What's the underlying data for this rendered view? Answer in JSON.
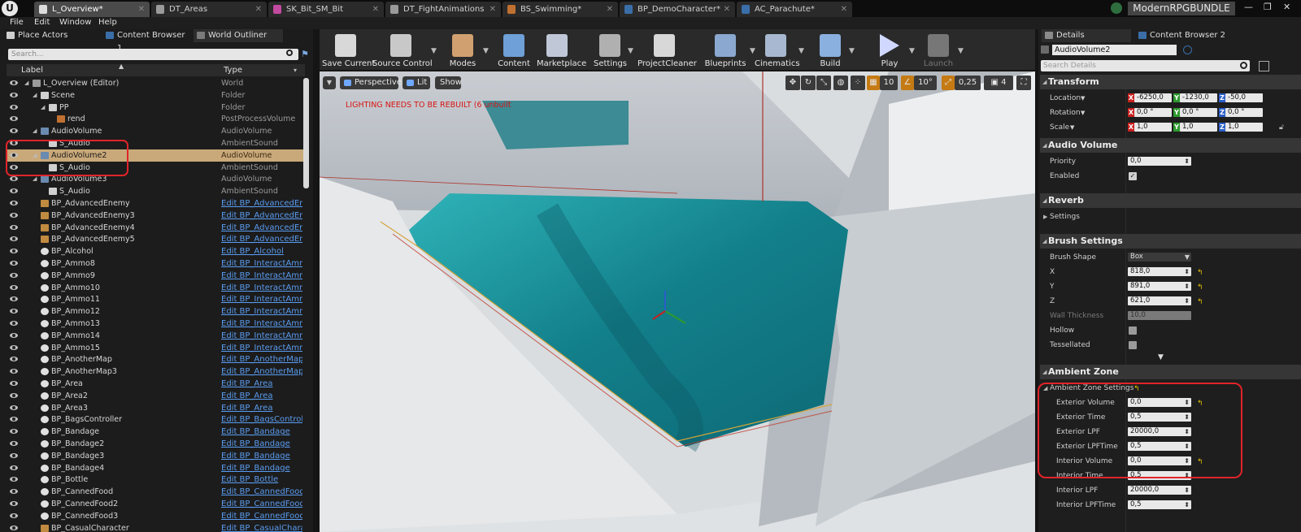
{
  "tabs": [
    {
      "label": "L_Overview*",
      "icon": "level-icon",
      "color": "#dcdcdc",
      "active": true
    },
    {
      "label": "DT_Areas",
      "icon": "datatable-icon",
      "color": "#9a9a9a"
    },
    {
      "label": "SK_Bit_SM_Bit",
      "icon": "skeleton-icon",
      "color": "#c24aa0"
    },
    {
      "label": "DT_FightAnimations",
      "icon": "datatable-icon",
      "color": "#9a9a9a"
    },
    {
      "label": "BS_Swimming*",
      "icon": "blendspace-icon",
      "color": "#c07030"
    },
    {
      "label": "BP_DemoCharacter*",
      "icon": "blueprint-icon",
      "color": "#3a6ea8"
    },
    {
      "label": "AC_Parachute*",
      "icon": "blueprint-icon",
      "color": "#3a6ea8"
    }
  ],
  "project_name": "ModernRPGBUNDLE",
  "menu": [
    "File",
    "Edit",
    "Window",
    "Help"
  ],
  "left_tabs": [
    "Place Actors",
    "Content Browser 1",
    "World Outliner"
  ],
  "search_placeholder": "Search...",
  "columns": {
    "label": "Label",
    "type": "Type"
  },
  "outliner_rows": [
    {
      "label": "L_Overview (Editor)",
      "type": "World",
      "indent": 0,
      "expanded": true,
      "icon": "world-icon"
    },
    {
      "label": "Scene",
      "type": "Folder",
      "indent": 1,
      "expanded": true,
      "icon": "folder-icon"
    },
    {
      "label": "PP",
      "type": "Folder",
      "indent": 2,
      "expanded": true,
      "icon": "folder-icon"
    },
    {
      "label": "rend",
      "type": "PostProcessVolume",
      "indent": 3,
      "icon": "volume-icon"
    },
    {
      "label": "AudioVolume",
      "type": "AudioVolume",
      "indent": 1,
      "expanded": true,
      "icon": "audio-volume-icon"
    },
    {
      "label": "S_Audio",
      "type": "AmbientSound",
      "indent": 2,
      "icon": "sound-icon"
    },
    {
      "label": "AudioVolume2",
      "type": "AudioVolume",
      "indent": 1,
      "expanded": true,
      "icon": "audio-volume-icon",
      "selected": true
    },
    {
      "label": "S_Audio",
      "type": "AmbientSound",
      "indent": 2,
      "icon": "sound-icon"
    },
    {
      "label": "AudioVolume3",
      "type": "AudioVolume",
      "indent": 1,
      "expanded": true,
      "icon": "audio-volume-icon"
    },
    {
      "label": "S_Audio",
      "type": "AmbientSound",
      "indent": 2,
      "icon": "sound-icon"
    },
    {
      "label": "BP_AdvancedEnemy",
      "type": "Edit BP_AdvancedEne",
      "indent": 1,
      "icon": "actor-icon",
      "link": true
    },
    {
      "label": "BP_AdvancedEnemy3",
      "type": "Edit BP_AdvancedEne",
      "indent": 1,
      "icon": "actor-icon",
      "link": true
    },
    {
      "label": "BP_AdvancedEnemy4",
      "type": "Edit BP_AdvancedEne",
      "indent": 1,
      "icon": "actor-icon",
      "link": true
    },
    {
      "label": "BP_AdvancedEnemy5",
      "type": "Edit BP_AdvancedEne",
      "indent": 1,
      "icon": "actor-icon",
      "link": true
    },
    {
      "label": "BP_Alcohol",
      "type": "Edit BP_Alcohol",
      "indent": 1,
      "icon": "sphere-icon",
      "link": true
    },
    {
      "label": "BP_Ammo8",
      "type": "Edit BP_InteractAmm",
      "indent": 1,
      "icon": "sphere-icon",
      "link": true
    },
    {
      "label": "BP_Ammo9",
      "type": "Edit BP_InteractAmm",
      "indent": 1,
      "icon": "sphere-icon",
      "link": true
    },
    {
      "label": "BP_Ammo10",
      "type": "Edit BP_InteractAmm",
      "indent": 1,
      "icon": "sphere-icon",
      "link": true
    },
    {
      "label": "BP_Ammo11",
      "type": "Edit BP_InteractAmm",
      "indent": 1,
      "icon": "sphere-icon",
      "link": true
    },
    {
      "label": "BP_Ammo12",
      "type": "Edit BP_InteractAmm",
      "indent": 1,
      "icon": "sphere-icon",
      "link": true
    },
    {
      "label": "BP_Ammo13",
      "type": "Edit BP_InteractAmm",
      "indent": 1,
      "icon": "sphere-icon",
      "link": true
    },
    {
      "label": "BP_Ammo14",
      "type": "Edit BP_InteractAmm",
      "indent": 1,
      "icon": "sphere-icon",
      "link": true
    },
    {
      "label": "BP_Ammo15",
      "type": "Edit BP_InteractAmm",
      "indent": 1,
      "icon": "sphere-icon",
      "link": true
    },
    {
      "label": "BP_AnotherMap",
      "type": "Edit BP_AnotherMap",
      "indent": 1,
      "icon": "sphere-icon",
      "link": true
    },
    {
      "label": "BP_AnotherMap3",
      "type": "Edit BP_AnotherMap",
      "indent": 1,
      "icon": "sphere-icon",
      "link": true
    },
    {
      "label": "BP_Area",
      "type": "Edit BP_Area",
      "indent": 1,
      "icon": "sphere-icon",
      "link": true
    },
    {
      "label": "BP_Area2",
      "type": "Edit BP_Area",
      "indent": 1,
      "icon": "sphere-icon",
      "link": true
    },
    {
      "label": "BP_Area3",
      "type": "Edit BP_Area",
      "indent": 1,
      "icon": "sphere-icon",
      "link": true
    },
    {
      "label": "BP_BagsController",
      "type": "Edit BP_BagsControll",
      "indent": 1,
      "icon": "sphere-icon",
      "link": true
    },
    {
      "label": "BP_Bandage",
      "type": "Edit BP_Bandage",
      "indent": 1,
      "icon": "sphere-icon",
      "link": true
    },
    {
      "label": "BP_Bandage2",
      "type": "Edit BP_Bandage",
      "indent": 1,
      "icon": "sphere-icon",
      "link": true
    },
    {
      "label": "BP_Bandage3",
      "type": "Edit BP_Bandage",
      "indent": 1,
      "icon": "sphere-icon",
      "link": true
    },
    {
      "label": "BP_Bandage4",
      "type": "Edit BP_Bandage",
      "indent": 1,
      "icon": "sphere-icon",
      "link": true
    },
    {
      "label": "BP_Bottle",
      "type": "Edit BP_Bottle",
      "indent": 1,
      "icon": "sphere-icon",
      "link": true
    },
    {
      "label": "BP_CannedFood",
      "type": "Edit BP_CannedFood",
      "indent": 1,
      "icon": "sphere-icon",
      "link": true
    },
    {
      "label": "BP_CannedFood2",
      "type": "Edit BP_CannedFood",
      "indent": 1,
      "icon": "sphere-icon",
      "link": true
    },
    {
      "label": "BP_CannedFood3",
      "type": "Edit BP_CannedFood",
      "indent": 1,
      "icon": "sphere-icon",
      "link": true
    },
    {
      "label": "BP_CasualCharacter",
      "type": "Edit BP_CasualCharac",
      "indent": 1,
      "icon": "actor-icon",
      "link": true
    }
  ],
  "toolbar": [
    {
      "label": "Save Current",
      "icon": "save-icon",
      "color": "#d8d8d8"
    },
    {
      "label": "Source Control",
      "icon": "source-control-icon",
      "color": "#c8c8c8",
      "dropdown": true
    },
    {
      "label": "Modes",
      "icon": "modes-icon",
      "color": "#d0a070",
      "dropdown": true
    },
    {
      "label": "Content",
      "icon": "content-icon",
      "color": "#6fa0d8"
    },
    {
      "label": "Marketplace",
      "icon": "marketplace-icon",
      "color": "#c0c8d8"
    },
    {
      "label": "Settings",
      "icon": "settings-icon",
      "color": "#b0b0b0",
      "dropdown": true
    },
    {
      "label": "ProjectCleaner",
      "icon": "trash-icon",
      "color": "#d8d8d8"
    },
    {
      "label": "Blueprints",
      "icon": "blueprints-icon",
      "color": "#8aa8d0",
      "dropdown": true
    },
    {
      "label": "Cinematics",
      "icon": "cinematics-icon",
      "color": "#a8b8d0",
      "dropdown": true
    },
    {
      "label": "Build",
      "icon": "build-icon",
      "color": "#8ab0e0",
      "dropdown": true
    },
    {
      "label": "Play",
      "icon": "play-icon",
      "color": "#d0d8ff",
      "dropdown": true
    },
    {
      "label": "Launch",
      "icon": "launch-icon",
      "color": "#777777",
      "dropdown": true,
      "disabled": true
    }
  ],
  "viewport": {
    "buttons": [
      "Perspective",
      "Lit",
      "Show"
    ],
    "warning": "LIGHTING NEEDS TO BE REBUILT (6 unbuilt",
    "grid_snap": "10",
    "rot_snap": "10°",
    "scale_snap": "0,25",
    "camera_speed": "4"
  },
  "details": {
    "tabs": [
      "Details",
      "Content Browser 2"
    ],
    "object_name": "AudioVolume2",
    "search_placeholder": "Search Details",
    "categories": {
      "transform": "Transform",
      "audio_volume": "Audio Volume",
      "reverb": "Reverb",
      "brush": "Brush Settings",
      "ambient": "Ambient Zone"
    },
    "transform": {
      "location_label": "Location",
      "location": [
        "-6250,0",
        "-1230,0",
        "-50,0"
      ],
      "rotation_label": "Rotation",
      "rotation": [
        "0,0 °",
        "0,0 °",
        "0,0 °"
      ],
      "scale_label": "Scale",
      "scale": [
        "1,0",
        "1,0",
        "1,0"
      ]
    },
    "axis": [
      "X",
      "Y",
      "Z"
    ],
    "axis_colors": [
      "#c8201e",
      "#2e9a2e",
      "#2a5ec8"
    ],
    "audio_volume": {
      "priority_label": "Priority",
      "priority": "0,0",
      "enabled_label": "Enabled",
      "enabled": true
    },
    "reverb": {
      "settings_label": "Settings"
    },
    "brush": {
      "shape_label": "Brush Shape",
      "shape": "Box",
      "x_label": "X",
      "x": "818,0",
      "y_label": "Y",
      "y": "891,0",
      "z_label": "Z",
      "z": "621,0",
      "wall_label": "Wall Thickness",
      "wall": "10,0",
      "hollow_label": "Hollow",
      "hollow": false,
      "tess_label": "Tessellated",
      "tess": false
    },
    "ambient": {
      "settings_label": "Ambient Zone Settings",
      "exterior_volume_label": "Exterior Volume",
      "exterior_volume": "0,0",
      "exterior_time_label": "Exterior Time",
      "exterior_time": "0,5",
      "exterior_lpf_label": "Exterior LPF",
      "exterior_lpf": "20000,0",
      "exterior_lpftime_label": "Exterior LPFTime",
      "exterior_lpftime": "0,5",
      "interior_volume_label": "Interior Volume",
      "interior_volume": "0,0",
      "interior_time_label": "Interior Time",
      "interior_time": "0,5",
      "interior_lpf_label": "Interior LPF",
      "interior_lpf": "20000,0",
      "interior_lpftime_label": "Interior LPFTime",
      "interior_lpftime": "0,5"
    }
  },
  "highlight_color": "#e0242a",
  "selection_color": "#c9a97a"
}
